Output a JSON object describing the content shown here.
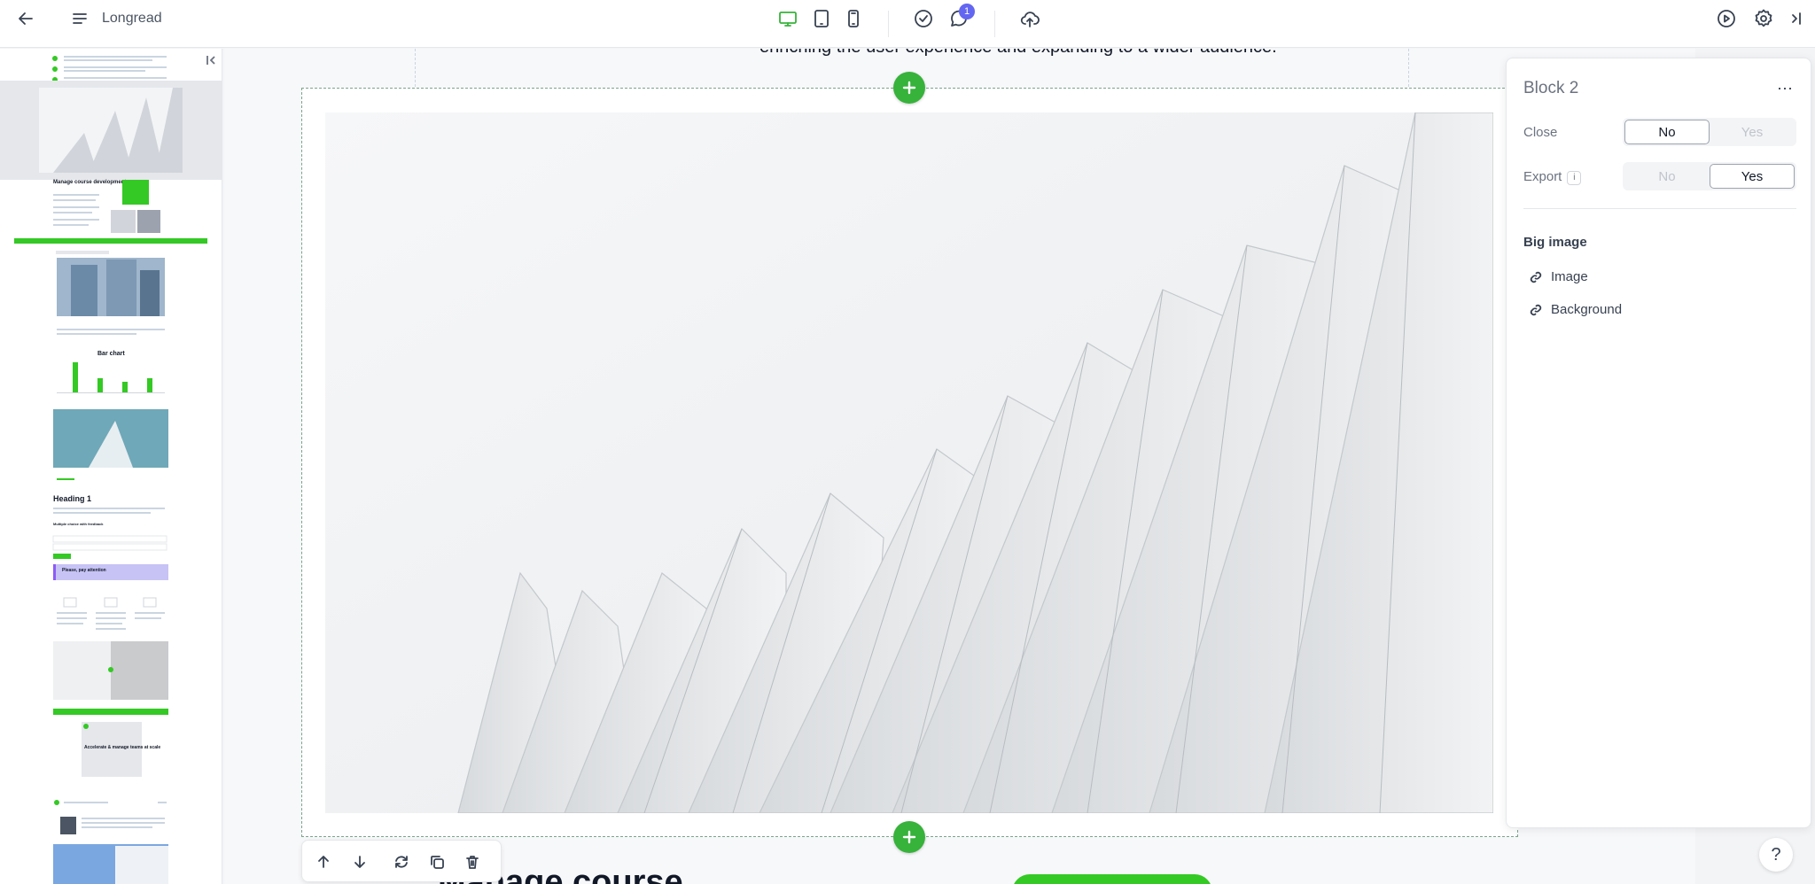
{
  "topbar": {
    "title": "Longread",
    "notification_count": "1"
  },
  "canvas": {
    "prev_block_text": "enriching the user experience and expanding to a wider audience.",
    "next_block_heading": "Manage course"
  },
  "thumbnails": {
    "chart_title": "Bar chart",
    "heading": "Heading 1",
    "multi_choice": "Multiple choice with feedback",
    "attention": "Please, pay attention",
    "course_title": "Manage course development",
    "teams_title": "Accelerate & manage teams at scale"
  },
  "panel": {
    "title": "Block 2",
    "close_label": "Close",
    "close_no": "No",
    "close_yes": "Yes",
    "close_value": "No",
    "export_label": "Export",
    "export_info": "i",
    "export_no": "No",
    "export_yes": "Yes",
    "export_value": "Yes",
    "section_title": "Big image",
    "items": [
      "Image",
      "Background"
    ]
  },
  "help_label": "?",
  "colors": {
    "accent_green": "#37b23b",
    "brand_green": "#34c924",
    "badge": "#6366f1",
    "thumb_highlight": "#8b5cf6"
  }
}
